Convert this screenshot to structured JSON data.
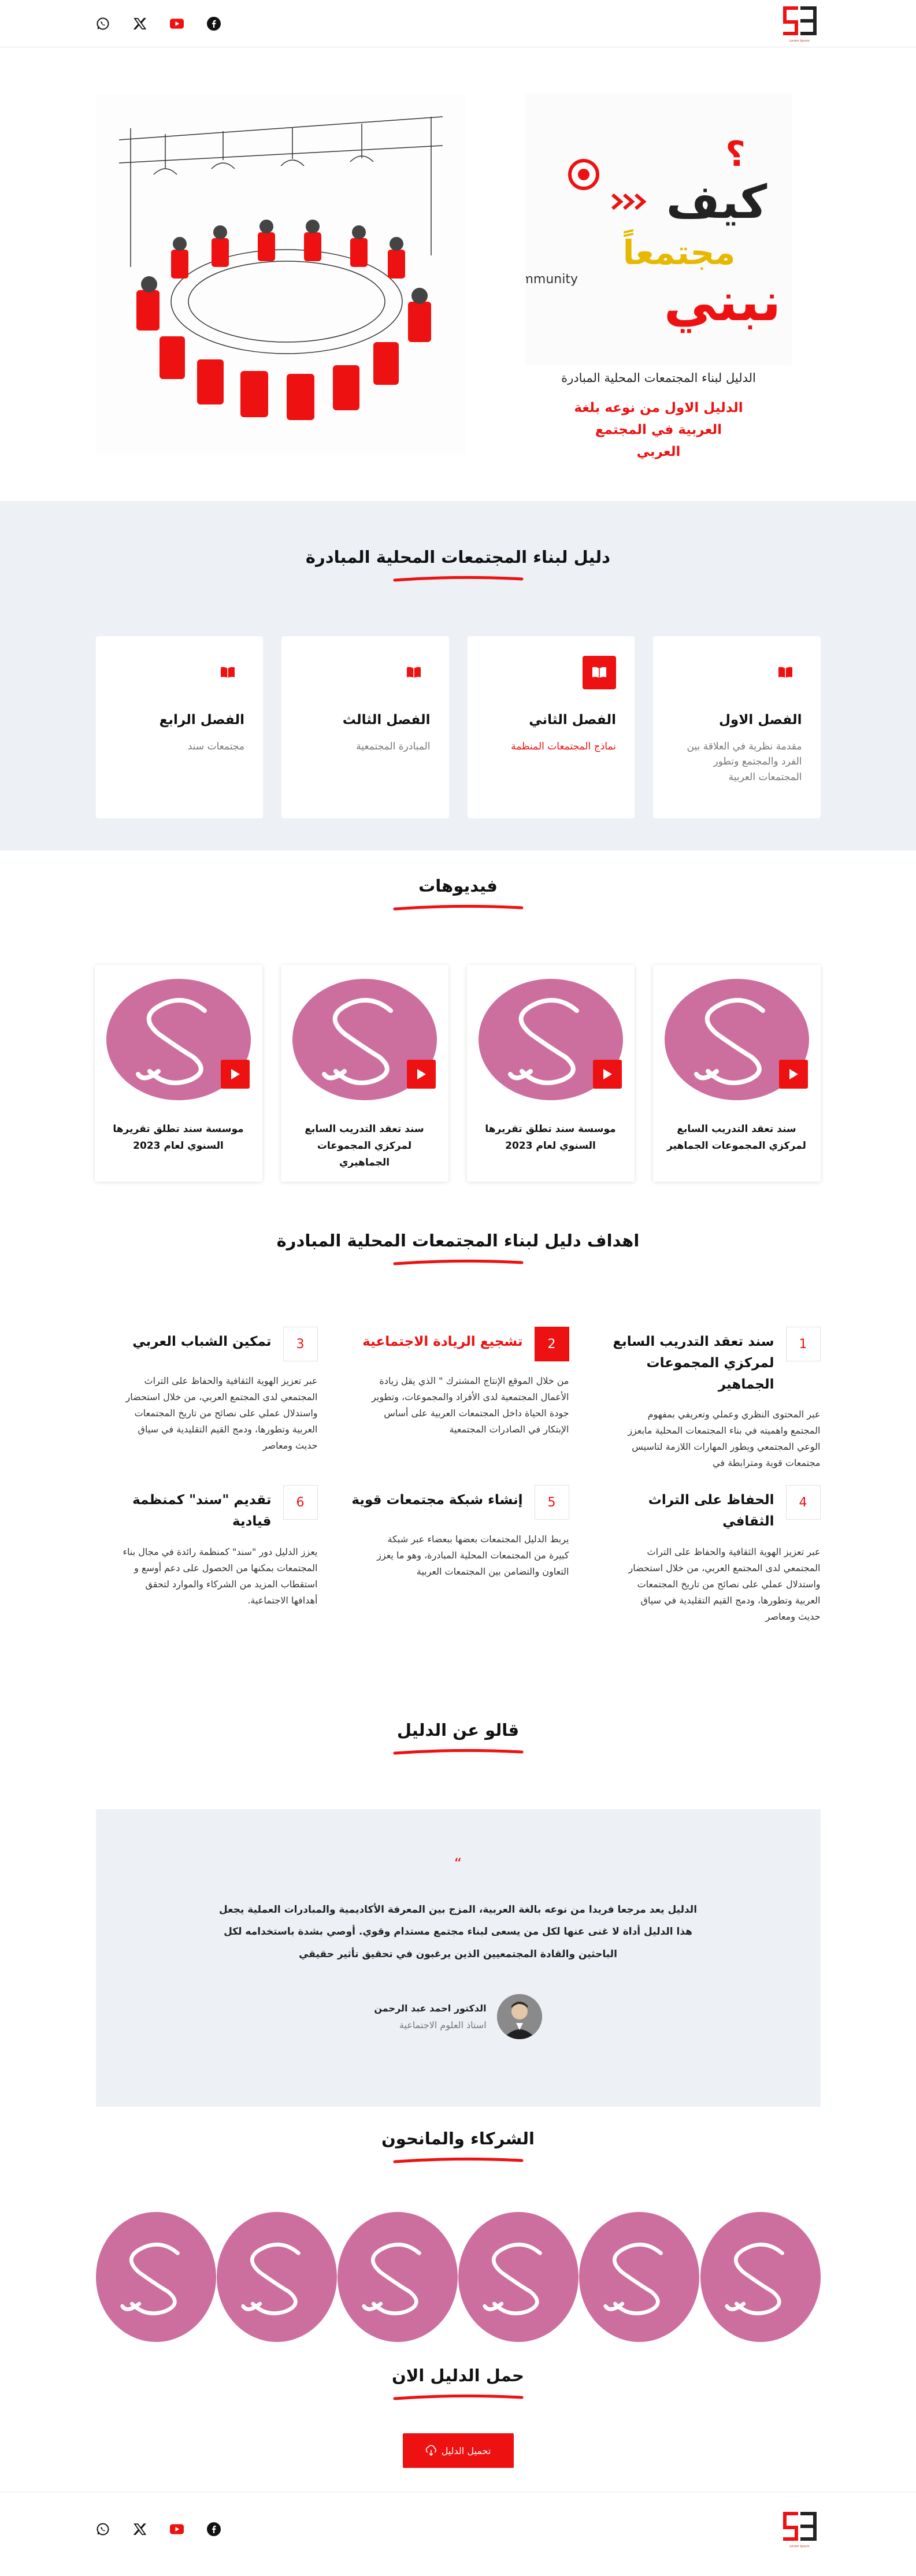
{
  "header": {
    "logo_caption": "Lorem Ipsum"
  },
  "socials": [
    {
      "name": "facebook-icon"
    },
    {
      "name": "youtube-icon"
    },
    {
      "name": "x-icon"
    },
    {
      "name": "whatsapp-icon"
    }
  ],
  "hero": {
    "book_cover": {
      "word1": "كيف",
      "word2": "نبني",
      "word3": "مجتمعاً",
      "english": "Community"
    },
    "subtitle": "الدليل لبناء المجتمعات المحلية المبادرة",
    "highlight": "الدليل الاول من نوعه بلغة العربية في المجتمع العربي"
  },
  "chapters": {
    "title": "دليل لبناء المجتمعات المحلية المبادرة",
    "items": [
      {
        "title": "الفصل الاول",
        "desc": "مقدمة نظرية في العلاقة بين الفرد والمجتمع وتطور المجتمعات العربية"
      },
      {
        "title": "الفصل الثاني",
        "desc": "نماذج المجتمعات المنظمة"
      },
      {
        "title": "الفصل الثالث",
        "desc": "المبادرة المجتمعية"
      },
      {
        "title": "الفصل الرابع",
        "desc": "مجتمعات سند"
      }
    ]
  },
  "videos": {
    "title": "فيديوهات",
    "items": [
      {
        "title": "سند تعقد التدريب السابع لمركزي المجموعات الجماهير"
      },
      {
        "title": "موسسة سند تطلق تقريرها السنوي لعام 2023"
      },
      {
        "title": "سند تعقد التدريب السابع لمركزي المجموعات الجماهيري"
      },
      {
        "title": "موسسة سند تطلق تقريرها السنوي لعام 2023"
      }
    ]
  },
  "goals": {
    "title": "اهداف دليل لبناء المجتمعات المحلية المبادرة",
    "items": [
      {
        "num": "1",
        "title": "سند تعقد التدريب السابع لمركزي المجموعات الجماهير",
        "desc": "عبر المحتوى النظري وعملي وتعريفي بمفهوم المجتمع واهميته في بناء المجتمعات المحلية مابعزز الوعي المجتمعي ويطور المهارات اللازمة لتاسيس مجتمعات قوية ومترابطة في"
      },
      {
        "num": "2",
        "title": "تشجيع الريادة الاجتماعية",
        "desc": "من خلال الموقع الإنتاج المشترك \" الذي يقل زيادة الأعمال المجتمعية لدى الأفراد والمجموعات، وتطوير جودة الحياة داخل المجتمعات العربية على أساس الإبتكار في الصادرات المجتمعية"
      },
      {
        "num": "3",
        "title": "تمكين الشباب العربي",
        "desc": "عبر تعزيز الهوية الثقافية والحفاظ على التراث المجتمعي لدى المجتمع العربي، من خلال استحضار واستدلال عملي على نصائح من تاريخ المجتمعات العربية وتطورها، ودمج القيم التقليدية في سياق حديث ومعاصر"
      },
      {
        "num": "4",
        "title": "الحفاظ على التراث الثقافي",
        "desc": "عبر تعزيز الهوية الثقافية والحفاظ على التراث المجتمعي لدى المجتمع العربي، من خلال استحضار واستدلال عملي على نصائح من تاريخ المجتمعات العربية وتطورها، ودمج القيم التقليدية في سياق حديث ومعاصر"
      },
      {
        "num": "5",
        "title": "إنشاء شبكة مجتمعات قوية",
        "desc": "يربط الدليل المجتمعات بعضها ببعضاء عبر شبكة كبيرة من المجتمعات المحلية المبادرة، وهو ما يعزز التعاون والتضامن بين المجتمعات العربية"
      },
      {
        "num": "6",
        "title": "تقديم \"سند\" كمنظمة قيادية",
        "desc": "يعزز الدليل دور \"سند\" كمنظمة رائدة في مجال بناء المجتمعات بمكنها من الحصول على دعم أوسع و استقطاب المزيد من الشركاء والموارد لتحقق أهدافها الاجتماعية."
      }
    ]
  },
  "testimonials": {
    "title": "قالو عن الدليل",
    "quote_mark": "“",
    "text": "الدليل يعد مرجعا فريدا من نوعه بالغة العربية، المزج بين المعرفة الأكاديمية والمبادرات العملية يجعل هذا الدليل أداة لا غنى عنها لكل من يسعى لبناء مجتمع مستدام وقوي. أوصي بشدة باستخدامه لكل الباحثين والقادة المجتمعيين الذين يرغبون في تحقيق تأثير حقيقي",
    "person_name": "الدكتور احمد عبد الرحمن",
    "person_role": "استاذ العلوم الاجتماعية"
  },
  "partners": {
    "title": "الشركاء والمانحون",
    "count": 6
  },
  "download": {
    "title": "حمل الدليل الان",
    "button_label": "تحميل الدليل"
  },
  "colors": {
    "accent": "#ee1111",
    "placeholder": "#cc6f9e",
    "section_bg": "#edf1f6"
  }
}
